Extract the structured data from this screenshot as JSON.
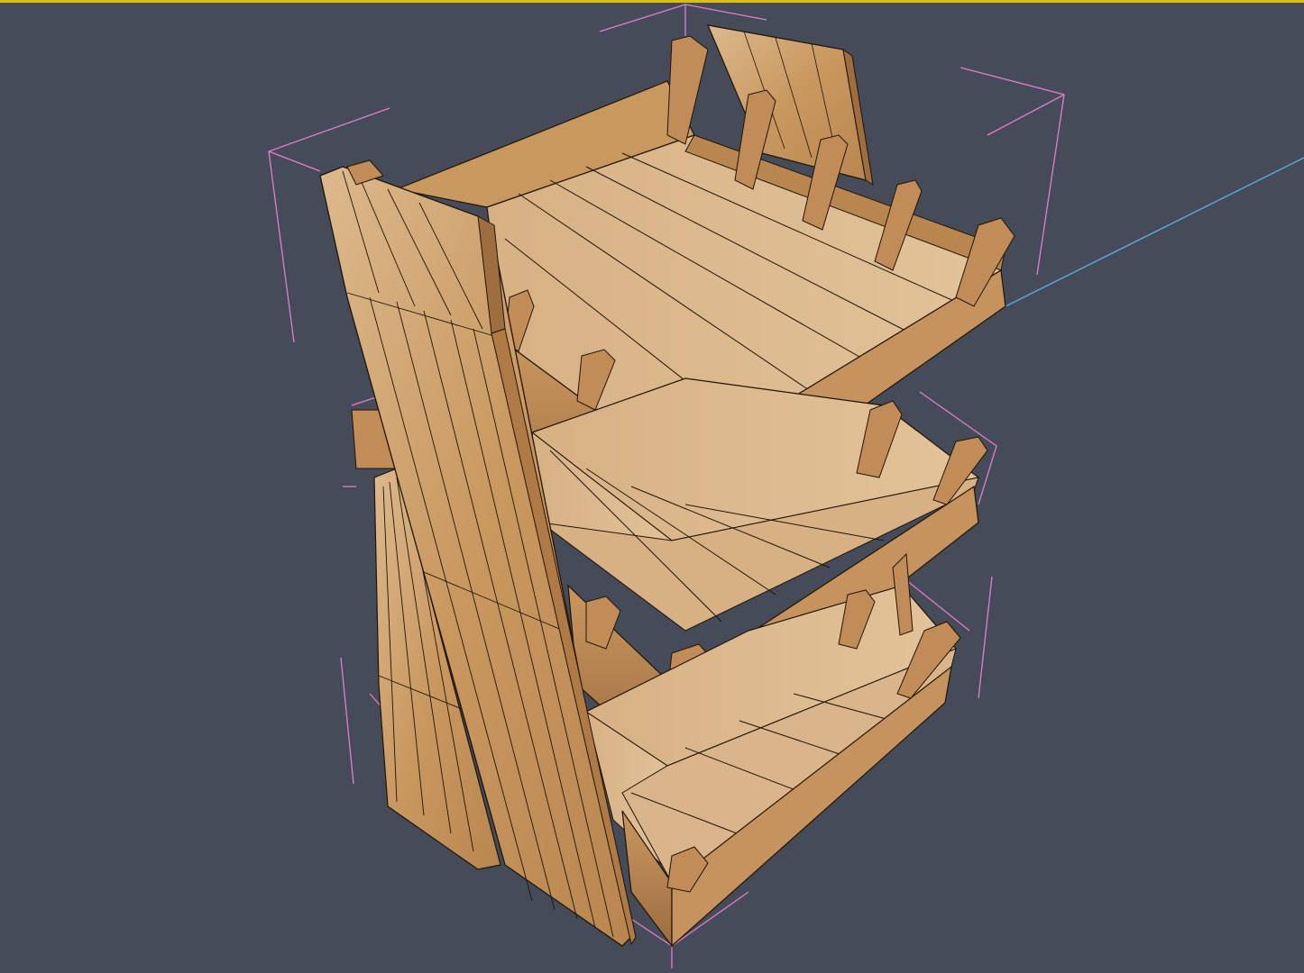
{
  "viewport": {
    "background_color": "#454b59",
    "top_border_color": "#d4c21b",
    "axis_color": "#5aa6dc",
    "bbox_color": "#e47ccf",
    "wire_color": "#1e1508"
  },
  "model": {
    "material": {
      "light": "#d8b285",
      "mid": "#c69565",
      "dark": "#9c6c40",
      "darker": "#7c5230"
    }
  }
}
